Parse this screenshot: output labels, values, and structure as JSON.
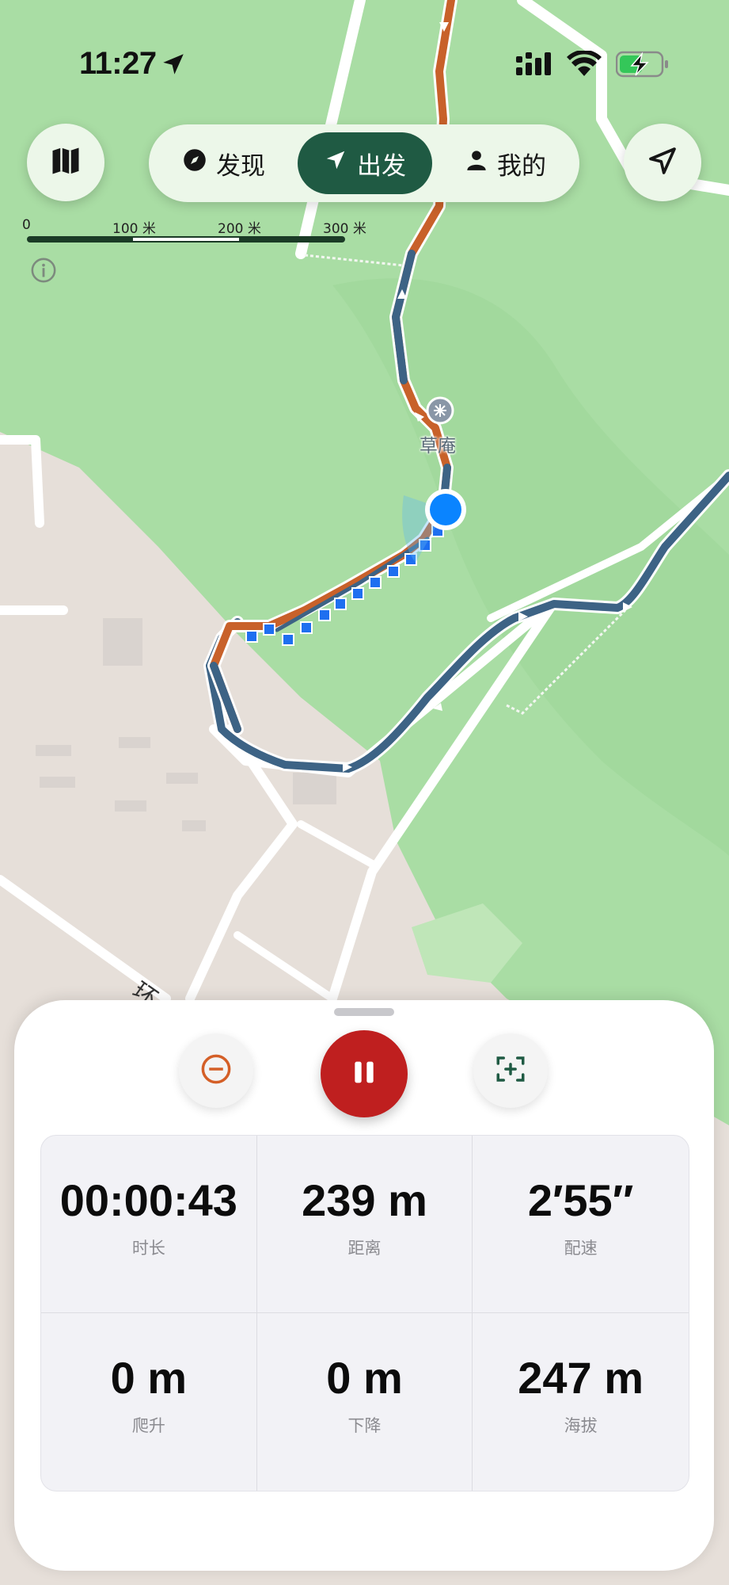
{
  "status_bar": {
    "time": "11:27"
  },
  "nav": {
    "discover": "发现",
    "go": "出发",
    "me": "我的"
  },
  "scale": {
    "labels": [
      "0",
      "100 米",
      "200 米",
      "300 米"
    ]
  },
  "map": {
    "poi_name": "草庵"
  },
  "stats": [
    {
      "value": "00:00:43",
      "label": "时长"
    },
    {
      "value": "239 m",
      "label": "距离"
    },
    {
      "value": "2′55″",
      "label": "配速"
    },
    {
      "value": "0 m",
      "label": "爬升"
    },
    {
      "value": "0 m",
      "label": "下降"
    },
    {
      "value": "247 m",
      "label": "海拔"
    }
  ],
  "colors": {
    "accent": "#1f5a43",
    "pause": "#bf1f1f",
    "track_orange": "#c8612a",
    "track_blue": "#3d6385",
    "location": "#0a84ff"
  },
  "icons": {
    "map_layers": "map-icon",
    "locate": "location-arrow-icon",
    "discover": "compass-icon",
    "go": "navigation-icon",
    "me": "person-icon",
    "zoom_out": "minus-circle-icon",
    "pause": "pause-icon",
    "focus": "plus-frame-icon"
  }
}
